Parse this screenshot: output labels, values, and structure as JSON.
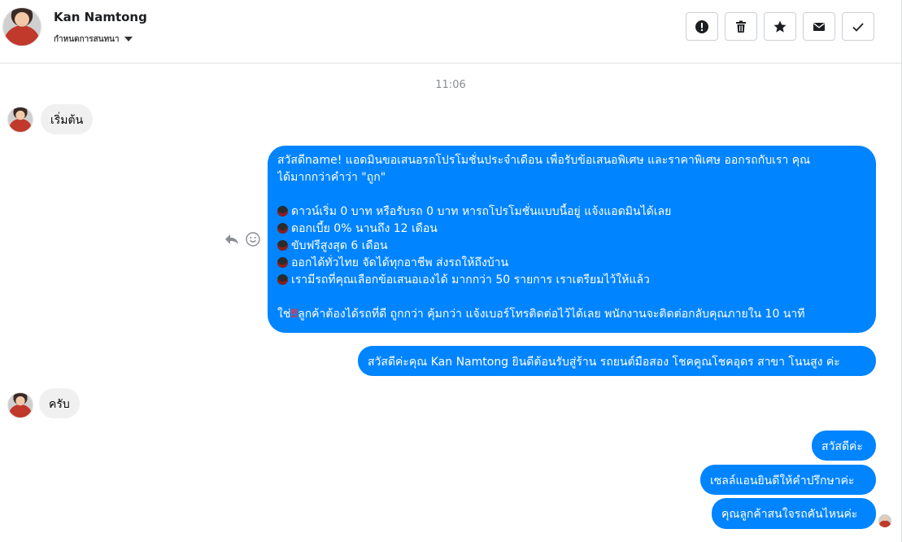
{
  "header": {
    "contact_name": "Kan Namtong",
    "status_label": "กำหนดการสนทนา",
    "toolbar": [
      {
        "name": "report-button",
        "icon": "exclamation-icon"
      },
      {
        "name": "delete-button",
        "icon": "trash-icon"
      },
      {
        "name": "star-button",
        "icon": "star-icon"
      },
      {
        "name": "mark-unread-button",
        "icon": "envelope-icon"
      },
      {
        "name": "mark-done-button",
        "icon": "check-icon"
      }
    ]
  },
  "conversation": {
    "timestamp": "11:06",
    "messages": [
      {
        "from": "contact",
        "text": "เริ่มต้น"
      },
      {
        "from": "page",
        "intro_1": "สวัสดีname! แอดมินขอเสนอรถโปรโมชั่นประจำเดือน เพื่อรับข้อเสนอพิเศษ และราคาพิเศษ ออกรถกับเรา คุณ",
        "intro_2": "ได้มากกว่าคำว่า \"ถูก\"",
        "bullets": [
          "ดาวน์เริ่ม 0 บาท หรือรับรถ 0 บาท หารถโปรโมชั่นแบบนี้อยู่ แจ้งแอดมินได้เลย",
          "ดอกเบี้ย 0% นานถึง 12 เดือน",
          "ขับฟรีสูงสุด 6 เดือน",
          "ออกได้ทั่วไทย จัดได้ทุกอาชีพ ส่งรถให้ถึงบ้าน",
          "เรามีรถที่คุณเลือกข้อเสนอเองได้ มากกว่า 50 รายการ เราเตรียมไว้ให้แล้ว"
        ],
        "closing_prefix": "ใช่",
        "closing_mark": "‼",
        "closing_text": "ลูกค้าต้องได้รถที่ดี ถูกกว่า คุ้มกว่า แจ้งเบอร์โทรติดต่อไว้ได้เลย พนักงานจะติดต่อกลับคุณภายใน 10 นาที"
      },
      {
        "from": "page",
        "text": "สวัสดีค่ะคุณ Kan Namtong ยินดีต้อนรับสู่ร้าน รถยนต์มือสอง โชคคูณโชคอุดร สาขา โนนสูง ค่ะ"
      },
      {
        "from": "contact",
        "text": "ครับ"
      },
      {
        "from": "page",
        "text": "สวัสดีค่ะ"
      },
      {
        "from": "page",
        "text": "เซลล์แอนยินดีให้คำปรึกษาค่ะ"
      },
      {
        "from": "page",
        "text": "คุณลูกค้าสนใจรถคันไหนค่ะ"
      }
    ]
  },
  "colors": {
    "outgoing_bubble": "#0084ff",
    "incoming_bubble": "#f0f0f0"
  }
}
